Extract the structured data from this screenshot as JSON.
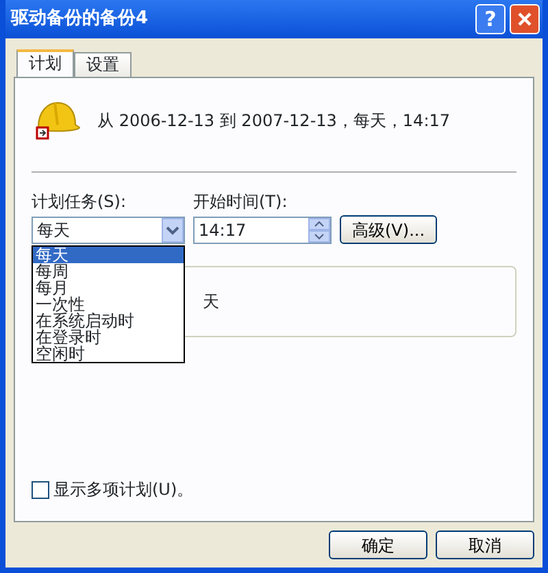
{
  "window": {
    "title": "驱动备份的备份4",
    "help": "?"
  },
  "tabs": [
    {
      "label": "计划",
      "selected": true
    },
    {
      "label": "设置",
      "selected": false
    }
  ],
  "summary": "从 2006-12-13 到 2007-12-13，每天，14:17",
  "schedule": {
    "label": "计划任务(S):",
    "value": "每天",
    "expanded": true,
    "options": [
      {
        "label": "每天",
        "selected": true
      },
      {
        "label": "每周",
        "selected": false
      },
      {
        "label": "每月",
        "selected": false
      },
      {
        "label": "一次性",
        "selected": false
      },
      {
        "label": "在系统启动时",
        "selected": false
      },
      {
        "label": "在登录时",
        "selected": false
      },
      {
        "label": "空闲时",
        "selected": false
      }
    ]
  },
  "start_time": {
    "label": "开始时间(T):",
    "value": "14:17"
  },
  "advanced_button": "高级(V)...",
  "interval": {
    "unit": "天"
  },
  "show_multiple": {
    "label": "显示多项计划(U)。",
    "checked": false
  },
  "buttons": [
    "确定",
    "取消"
  ]
}
